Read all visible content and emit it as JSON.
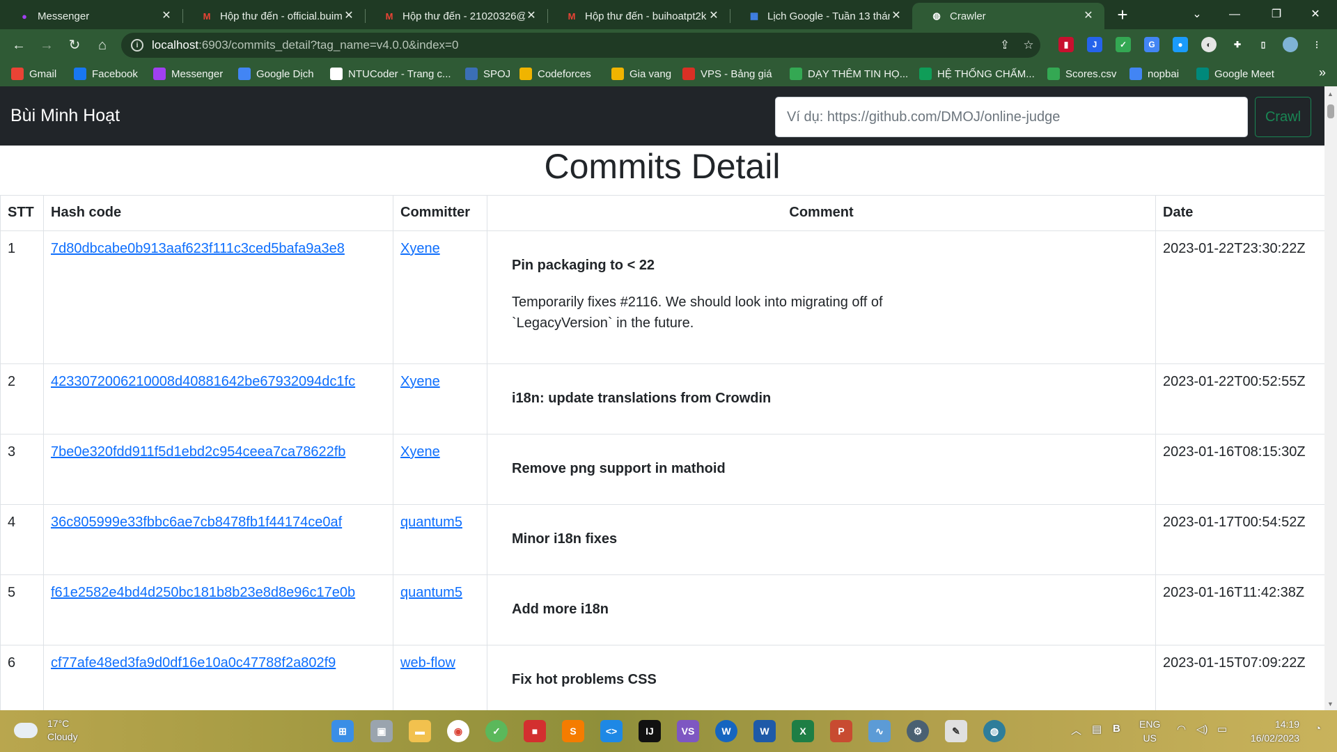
{
  "browser": {
    "tabs": [
      {
        "title": "Messenger",
        "icon": "messenger-icon",
        "color": "#a040f0"
      },
      {
        "title": "Hộp thư đến - official.buim",
        "icon": "gmail-icon",
        "color": "#ea4335"
      },
      {
        "title": "Hộp thư đến - 21020326@v",
        "icon": "gmail-icon",
        "color": "#ea4335"
      },
      {
        "title": "Hộp thư đến - buihoatpt2k",
        "icon": "gmail-icon",
        "color": "#ea4335"
      },
      {
        "title": "Lịch Google - Tuần 13 thán",
        "icon": "calendar-icon",
        "color": "#4285f4"
      },
      {
        "title": "Crawler",
        "icon": "globe-icon",
        "color": "#ffffff",
        "active": true
      }
    ],
    "url_host": "localhost",
    "url_rest": ":6903/commits_detail?tag_name=v4.0.0&index=0",
    "bookmarks": [
      {
        "label": "Gmail",
        "color": "#ea4335"
      },
      {
        "label": "Facebook",
        "color": "#1877f2"
      },
      {
        "label": "Messenger",
        "color": "#a040f0"
      },
      {
        "label": "Google Dịch",
        "color": "#4285f4"
      },
      {
        "label": "NTUCoder - Trang c...",
        "color": "#ffffff"
      },
      {
        "label": "SPOJ",
        "color": "#3b6fb6"
      },
      {
        "label": "Codeforces",
        "color": "#f0b400"
      },
      {
        "label": "Gia vang",
        "color": "#f0b400"
      },
      {
        "label": "VPS - Bảng giá",
        "color": "#d93025"
      },
      {
        "label": "DẠY THÊM TIN HỌ...",
        "color": "#34a853"
      },
      {
        "label": "HỆ THỐNG CHẤM...",
        "color": "#0f9d58"
      },
      {
        "label": "Scores.csv",
        "color": "#34a853"
      },
      {
        "label": "nopbai",
        "color": "#4285f4"
      },
      {
        "label": "Google Meet",
        "color": "#00897b"
      }
    ]
  },
  "site": {
    "brand": "Bùi Minh Hoạt",
    "search_placeholder": "Ví dụ: https://github.com/DMOJ/online-judge",
    "crawl_label": "Crawl",
    "page_title": "Commits Detail",
    "table": {
      "headers": {
        "stt": "STT",
        "hash": "Hash code",
        "committer": "Committer",
        "comment": "Comment",
        "date": "Date"
      },
      "rows": [
        {
          "stt": "1",
          "hash": "7d80dbcabe0b913aaf623f111c3ced5bafa9a3e8",
          "committer": "Xyene",
          "title": "Pin packaging to < 22",
          "body": [
            "Temporarily fixes #2116. We should look into migrating off of",
            "`LegacyVersion` in the future."
          ],
          "date": "2023-01-22T23:30:22Z"
        },
        {
          "stt": "2",
          "hash": "4233072006210008d40881642be67932094dc1fc",
          "committer": "Xyene",
          "title": "i18n: update translations from Crowdin",
          "body": [],
          "date": "2023-01-22T00:52:55Z"
        },
        {
          "stt": "3",
          "hash": "7be0e320fdd911f5d1ebd2c954ceea7ca78622fb",
          "committer": "Xyene",
          "title": "Remove png support in mathoid",
          "body": [],
          "date": "2023-01-16T08:15:30Z"
        },
        {
          "stt": "4",
          "hash": "36c805999e33fbbc6ae7cb8478fb1f44174ce0af",
          "committer": "quantum5",
          "title": "Minor i18n fixes",
          "body": [],
          "date": "2023-01-17T00:54:52Z"
        },
        {
          "stt": "5",
          "hash": "f61e2582e4bd4d250bc181b8b23e8d8e96c17e0b",
          "committer": "quantum5",
          "title": "Add more i18n",
          "body": [],
          "date": "2023-01-16T11:42:38Z"
        },
        {
          "stt": "6",
          "hash": "cf77afe48ed3fa9d0df16e10a0c47788f2a802f9",
          "committer": "web-flow",
          "title": "Fix hot problems CSS",
          "body": [],
          "date": "2023-01-15T07:09:22Z"
        }
      ]
    }
  },
  "taskbar": {
    "weather_temp": "17°C",
    "weather_desc": "Cloudy",
    "lang_1": "ENG",
    "lang_2": "US",
    "time": "14:19",
    "date": "16/02/2023"
  }
}
